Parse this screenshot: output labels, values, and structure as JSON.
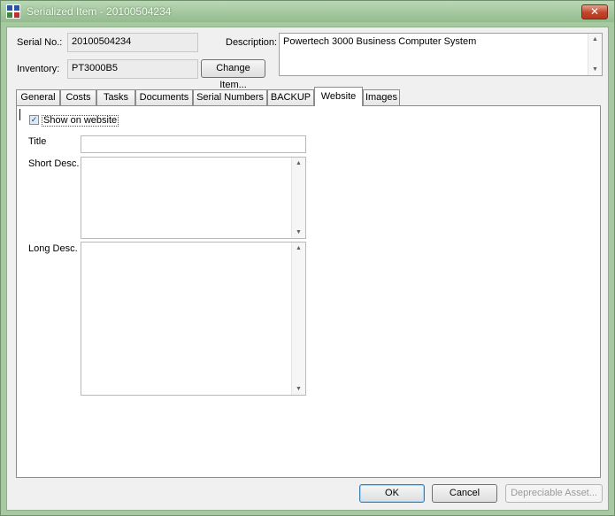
{
  "window": {
    "title": "Serialized Item - 20100504234",
    "close_glyph": "✕"
  },
  "header": {
    "serial_label": "Serial No.:",
    "serial_value": "20100504234",
    "inventory_label": "Inventory:",
    "inventory_value": "PT3000B5",
    "change_item_label": "Change Item...",
    "description_label": "Description:",
    "description_value": "Powertech 3000 Business Computer System"
  },
  "tabs": [
    {
      "label": "General"
    },
    {
      "label": "Costs"
    },
    {
      "label": "Tasks"
    },
    {
      "label": "Documents"
    },
    {
      "label": "Serial Numbers"
    },
    {
      "label": "BACKUP"
    },
    {
      "label": "Website",
      "active": true
    },
    {
      "label": "Images"
    }
  ],
  "website_tab": {
    "show_on_website_label": "Show on website",
    "show_on_website_checked": true,
    "title_label": "Title",
    "title_value": "",
    "short_desc_label": "Short Desc.",
    "short_desc_value": "",
    "long_desc_label": "Long Desc.",
    "long_desc_value": ""
  },
  "footer": {
    "ok_label": "OK",
    "cancel_label": "Cancel",
    "depreciable_label": "Depreciable Asset..."
  },
  "icons": {
    "app": "app-icon",
    "scroll_up": "▲",
    "scroll_down": "▼",
    "check": "✓"
  },
  "colors": {
    "title_bar": "#a7c9a2",
    "close_button": "#c2442b"
  }
}
